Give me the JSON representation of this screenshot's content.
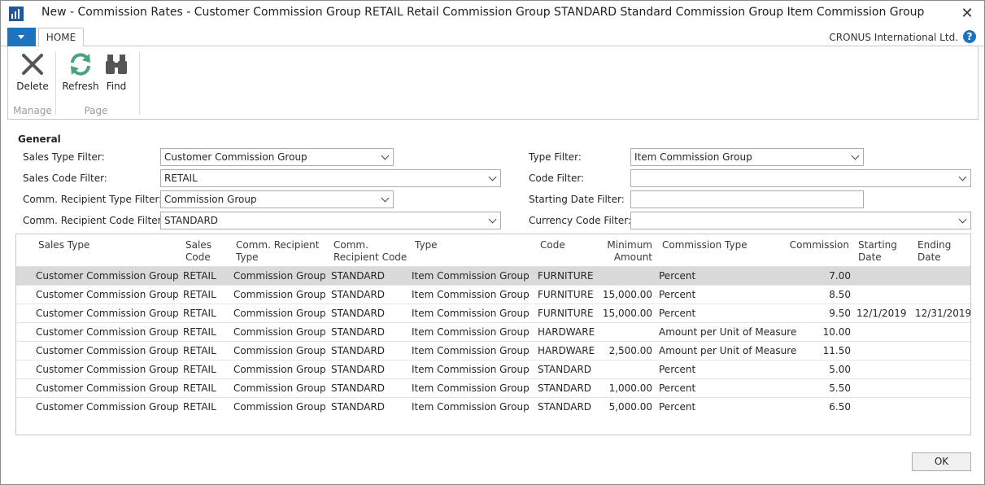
{
  "window": {
    "title": "New - Commission Rates - Customer Commission Group RETAIL Retail Commission Group STANDARD Standard Commission Group Item Commission Group",
    "company": "CRONUS International Ltd."
  },
  "ribbon": {
    "tab_home": "HOME",
    "delete": "Delete",
    "refresh": "Refresh",
    "find": "Find",
    "group_manage": "Manage",
    "group_page": "Page"
  },
  "general": {
    "title": "General",
    "sales_type_filter_label": "Sales Type Filter:",
    "sales_type_filter_value": "Customer Commission Group",
    "sales_code_filter_label": "Sales Code Filter:",
    "sales_code_filter_value": "RETAIL",
    "comm_recipient_type_filter_label": "Comm. Recipient Type Filter:",
    "comm_recipient_type_filter_value": "Commission Group",
    "comm_recipient_code_filter_label": "Comm. Recipient Code Filter:",
    "comm_recipient_code_filter_value": "STANDARD",
    "type_filter_label": "Type Filter:",
    "type_filter_value": "Item Commission Group",
    "code_filter_label": "Code Filter:",
    "code_filter_value": "",
    "starting_date_filter_label": "Starting Date Filter:",
    "starting_date_filter_value": "",
    "currency_code_filter_label": "Currency Code Filter:",
    "currency_code_filter_value": ""
  },
  "grid": {
    "headers": {
      "sales_type": "Sales Type",
      "sales_code_1": "Sales",
      "sales_code_2": "Code",
      "recipient_type_1": "Comm. Recipient",
      "recipient_type_2": "Type",
      "recipient_code_1": "Comm.",
      "recipient_code_2": "Recipient Code",
      "type": "Type",
      "code": "Code",
      "min_amount_1": "Minimum",
      "min_amount_2": "Amount",
      "commission_type": "Commission Type",
      "commission": "Commission",
      "starting_date_1": "Starting",
      "starting_date_2": "Date",
      "ending_date_1": "Ending",
      "ending_date_2": "Date"
    },
    "rows": [
      {
        "sales_type": "Customer Commission Group",
        "sales_code": "RETAIL",
        "recipient_type": "Commission Group",
        "recipient_code": "STANDARD",
        "type": "Item Commission Group",
        "code": "FURNITURE",
        "min_amount": "",
        "commission_type": "Percent",
        "commission": "7.00",
        "starting_date": "",
        "ending_date": ""
      },
      {
        "sales_type": "Customer Commission Group",
        "sales_code": "RETAIL",
        "recipient_type": "Commission Group",
        "recipient_code": "STANDARD",
        "type": "Item Commission Group",
        "code": "FURNITURE",
        "min_amount": "15,000.00",
        "commission_type": "Percent",
        "commission": "8.50",
        "starting_date": "",
        "ending_date": ""
      },
      {
        "sales_type": "Customer Commission Group",
        "sales_code": "RETAIL",
        "recipient_type": "Commission Group",
        "recipient_code": "STANDARD",
        "type": "Item Commission Group",
        "code": "FURNITURE",
        "min_amount": "15,000.00",
        "commission_type": "Percent",
        "commission": "9.50",
        "starting_date": "12/1/2019",
        "ending_date": "12/31/2019"
      },
      {
        "sales_type": "Customer Commission Group",
        "sales_code": "RETAIL",
        "recipient_type": "Commission Group",
        "recipient_code": "STANDARD",
        "type": "Item Commission Group",
        "code": "HARDWARE",
        "min_amount": "",
        "commission_type": "Amount per Unit of Measure",
        "commission": "10.00",
        "starting_date": "",
        "ending_date": ""
      },
      {
        "sales_type": "Customer Commission Group",
        "sales_code": "RETAIL",
        "recipient_type": "Commission Group",
        "recipient_code": "STANDARD",
        "type": "Item Commission Group",
        "code": "HARDWARE",
        "min_amount": "2,500.00",
        "commission_type": "Amount per Unit of Measure",
        "commission": "11.50",
        "starting_date": "",
        "ending_date": ""
      },
      {
        "sales_type": "Customer Commission Group",
        "sales_code": "RETAIL",
        "recipient_type": "Commission Group",
        "recipient_code": "STANDARD",
        "type": "Item Commission Group",
        "code": "STANDARD",
        "min_amount": "",
        "commission_type": "Percent",
        "commission": "5.00",
        "starting_date": "",
        "ending_date": ""
      },
      {
        "sales_type": "Customer Commission Group",
        "sales_code": "RETAIL",
        "recipient_type": "Commission Group",
        "recipient_code": "STANDARD",
        "type": "Item Commission Group",
        "code": "STANDARD",
        "min_amount": "1,000.00",
        "commission_type": "Percent",
        "commission": "5.50",
        "starting_date": "",
        "ending_date": ""
      },
      {
        "sales_type": "Customer Commission Group",
        "sales_code": "RETAIL",
        "recipient_type": "Commission Group",
        "recipient_code": "STANDARD",
        "type": "Item Commission Group",
        "code": "STANDARD",
        "min_amount": "5,000.00",
        "commission_type": "Percent",
        "commission": "6.50",
        "starting_date": "",
        "ending_date": ""
      }
    ]
  },
  "footer": {
    "ok": "OK"
  },
  "colors": {
    "accent": "#1e73be",
    "selected_row": "#dadada"
  },
  "icons": [
    "app-icon",
    "close-icon",
    "help-icon",
    "delete-icon",
    "refresh-icon",
    "find-icon",
    "dropdown-arrow-icon"
  ]
}
